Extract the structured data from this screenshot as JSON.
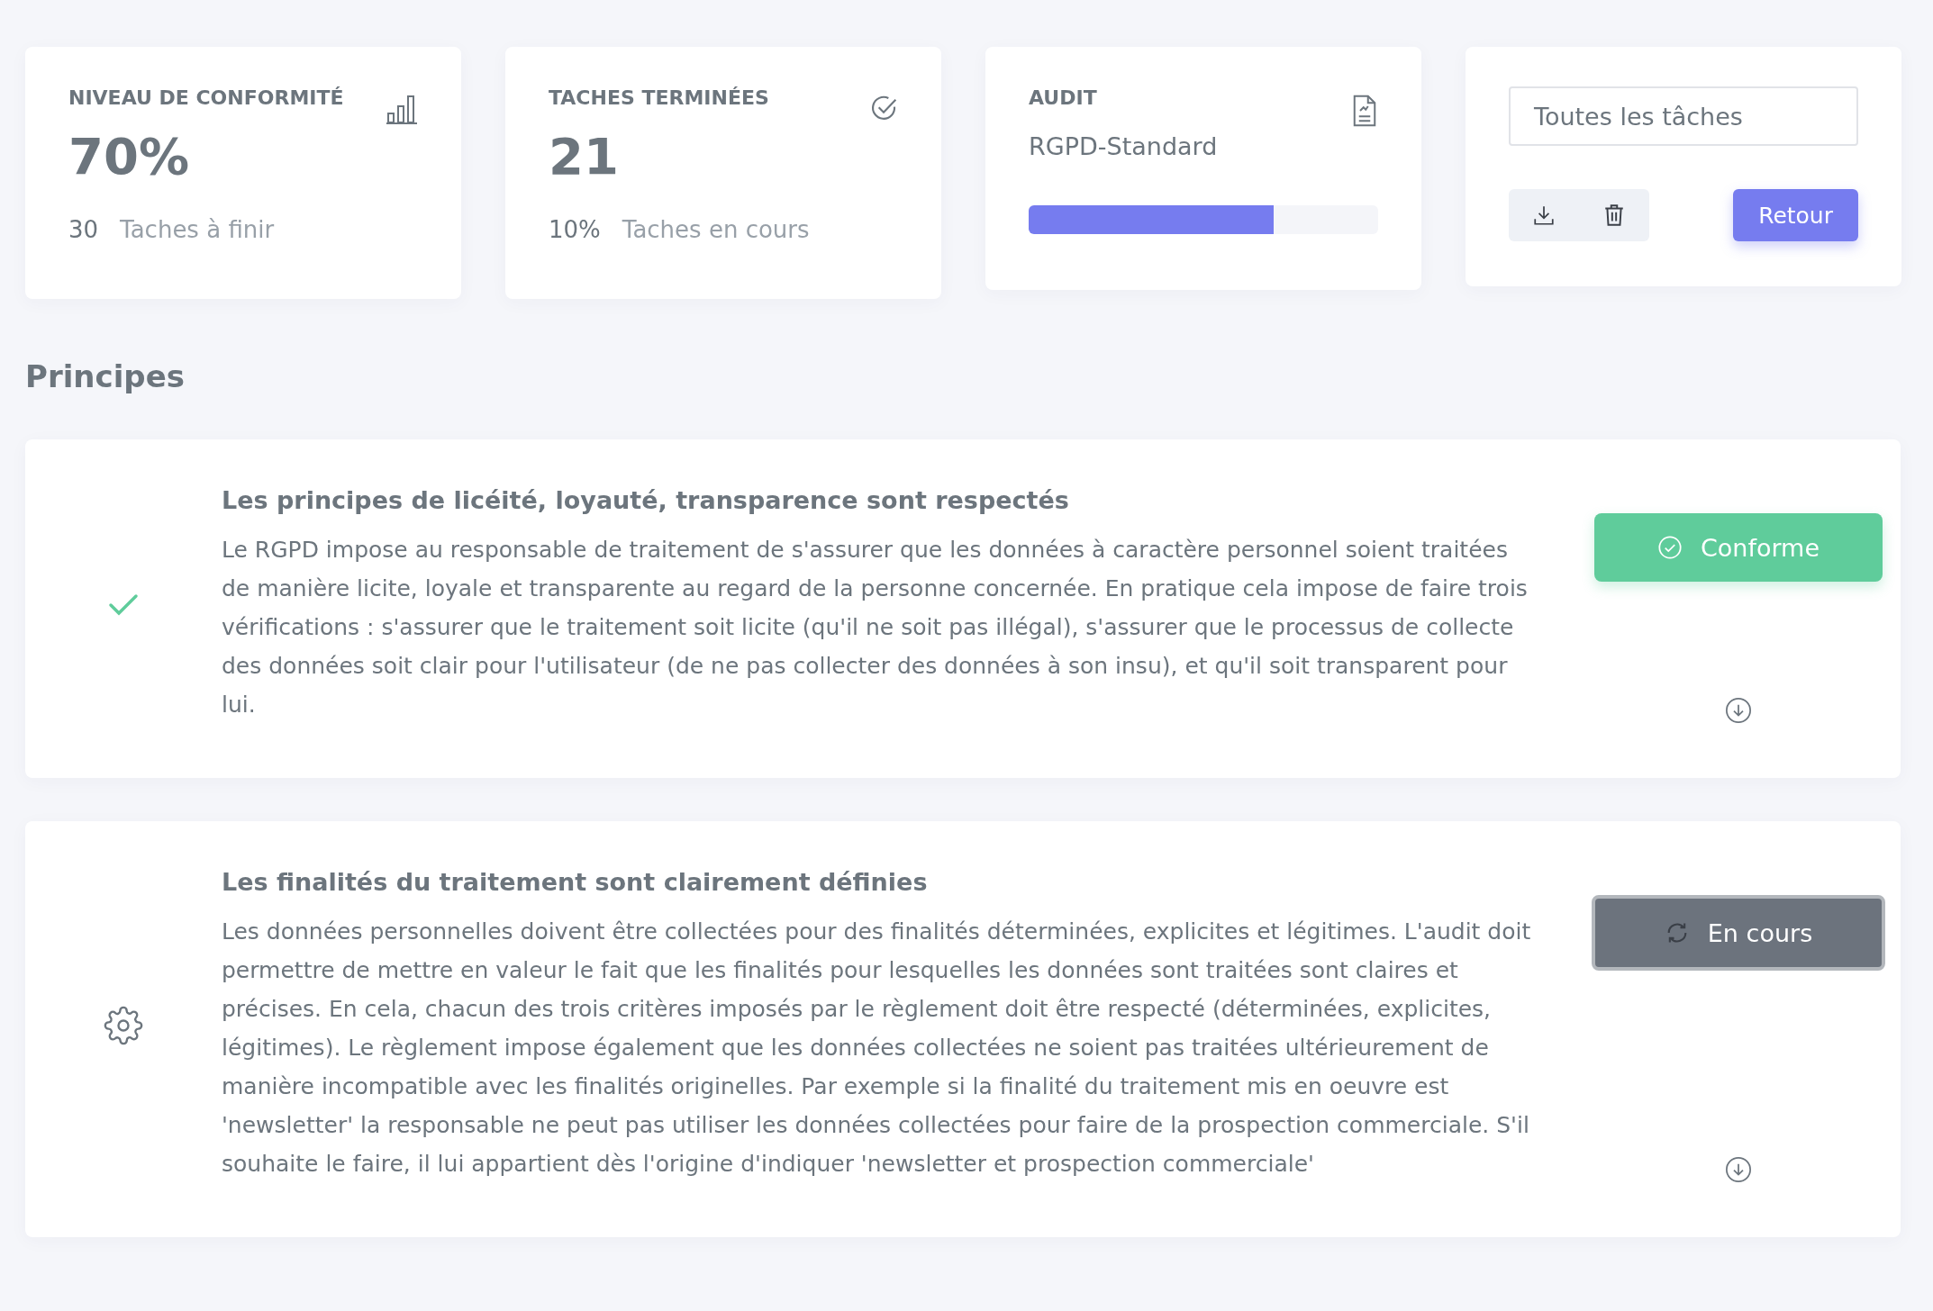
{
  "stats": [
    {
      "kind": "metric",
      "title": "NIVEAU DE CONFORMITÉ",
      "value": "70%",
      "sub_value": "30",
      "sub_label": "Taches à finir"
    },
    {
      "kind": "metric",
      "title": "TACHES TERMINÉES",
      "value": "21",
      "sub_value": "10%",
      "sub_label": "Taches en cours"
    },
    {
      "kind": "audit",
      "title": "AUDIT",
      "subtitle": "RGPD-Standard",
      "level": 0.7
    }
  ],
  "actions": {
    "filter": {
      "value": "Toutes les tâches"
    },
    "back_button": "Retour"
  },
  "section_title": "Principes",
  "principles": [
    {
      "kind": "conforme",
      "title": "Les principes de licéité, loyauté, transparence sont respectés",
      "description": "Le RGPD impose au responsable de traitement de s'assurer que les données à caractère personnel soient traitées de manière licite, loyale et transparente au regard de la personne concernée. En pratique cela impose de faire trois vérifications : s'assurer que le traitement soit licite (qu'il ne soit pas illégal), s'assurer que le processus de collecte des données soit clair pour l'utilisateur (de ne pas collecter des données à son insu), et qu'il soit transparent pour lui.",
      "status_label": "Conforme"
    },
    {
      "kind": "en_cours",
      "title": "Les finalités du traitement sont clairement définies",
      "description": "Les données personnelles doivent être collectées pour des finalités déterminées, explicites et légitimes. L'audit doit permettre de mettre en valeur le fait que les finalités pour lesquelles les données sont traitées sont claires et précises. En cela, chacun des trois critères imposés par le règlement doit être respecté (déterminées, explicites, légitimes). Le règlement impose également que les données collectées ne soient pas traitées ultérieurement de manière incompatible avec les finalités originelles. Par exemple si la finalité du traitement mis en oeuvre est 'newsletter' la responsable ne peut pas utiliser les données collectées pour faire de la prospection commerciale. S'il souhaite le faire, il lui appartient dès l'origine d'indiquer 'newsletter et prospection commerciale'",
      "status_label": "En cours"
    }
  ]
}
